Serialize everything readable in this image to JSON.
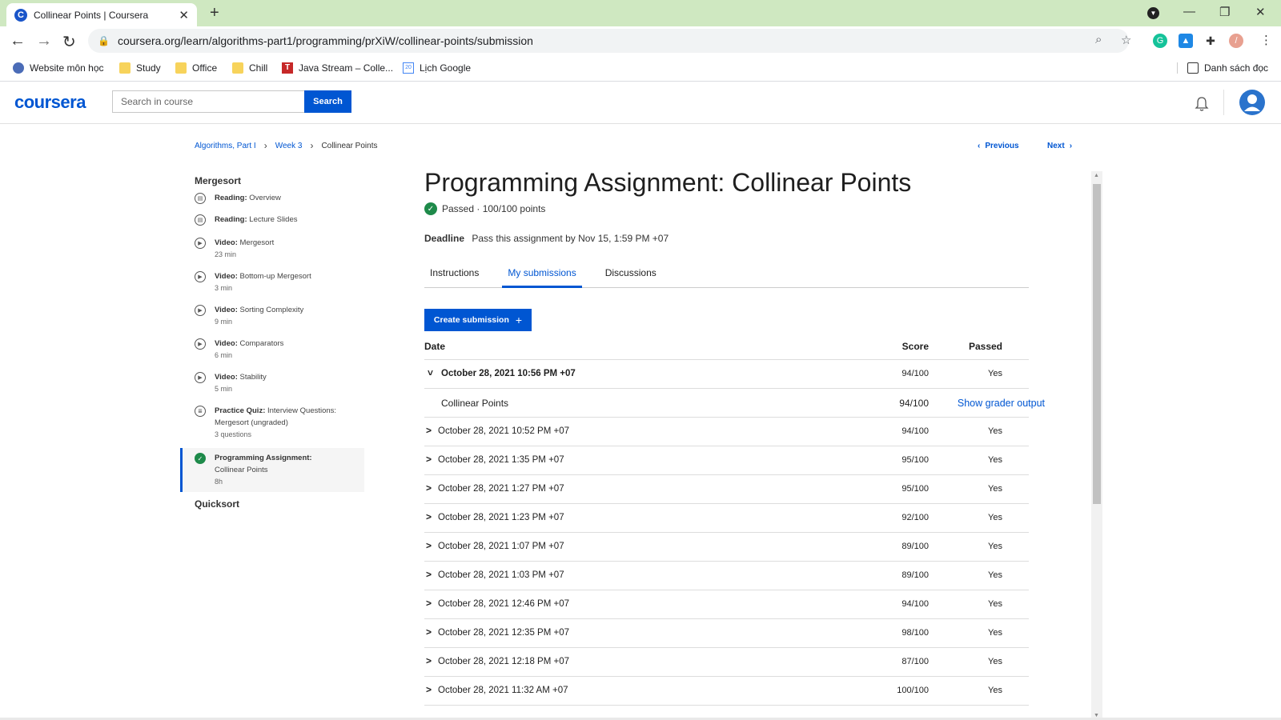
{
  "browser": {
    "tab_title": "Collinear Points | Coursera",
    "url": "coursera.org/learn/algorithms-part1/programming/prXiW/collinear-points/submission",
    "bookmarks": [
      "Website môn học",
      "Study",
      "Office",
      "Chill",
      "Java Stream – Colle...",
      "Lịch Google"
    ],
    "reading_list": "Danh sách đọc"
  },
  "header": {
    "logo": "coursera",
    "search_placeholder": "Search in course",
    "search_button": "Search"
  },
  "breadcrumb": {
    "course": "Algorithms, Part I",
    "week": "Week 3",
    "current": "Collinear Points",
    "previous": "Previous",
    "next": "Next"
  },
  "sidebar": {
    "section": "Mergesort",
    "items": [
      {
        "type": "Reading:",
        "name": "Overview",
        "meta": ""
      },
      {
        "type": "Reading:",
        "name": "Lecture Slides",
        "meta": ""
      },
      {
        "type": "Video:",
        "name": "Mergesort",
        "meta": "23 min"
      },
      {
        "type": "Video:",
        "name": "Bottom-up Mergesort",
        "meta": "3 min"
      },
      {
        "type": "Video:",
        "name": "Sorting Complexity",
        "meta": "9 min"
      },
      {
        "type": "Video:",
        "name": "Comparators",
        "meta": "6 min"
      },
      {
        "type": "Video:",
        "name": "Stability",
        "meta": "5 min"
      },
      {
        "type": "Practice Quiz:",
        "name": "Interview Questions: Mergesort (ungraded)",
        "meta": "3 questions"
      },
      {
        "type": "Programming Assignment:",
        "name": "Collinear Points",
        "meta": "8h"
      }
    ],
    "next_section": "Quicksort"
  },
  "main": {
    "title": "Programming Assignment: Collinear Points",
    "status": "Passed · 100/100 points",
    "deadline_label": "Deadline",
    "deadline_text": "Pass this assignment by Nov 15, 1:59 PM +07",
    "tabs": [
      "Instructions",
      "My submissions",
      "Discussions"
    ],
    "create_button": "Create submission",
    "table": {
      "headers": {
        "date": "Date",
        "score": "Score",
        "passed": "Passed"
      },
      "expanded_row": {
        "date": "October 28, 2021 10:56 PM +07",
        "score": "94/100",
        "passed": "Yes"
      },
      "sub_row": {
        "name": "Collinear Points",
        "score": "94/100",
        "link": "Show grader output"
      },
      "rows": [
        {
          "date": "October 28, 2021 10:52 PM +07",
          "score": "94/100",
          "passed": "Yes"
        },
        {
          "date": "October 28, 2021 1:35 PM +07",
          "score": "95/100",
          "passed": "Yes"
        },
        {
          "date": "October 28, 2021 1:27 PM +07",
          "score": "95/100",
          "passed": "Yes"
        },
        {
          "date": "October 28, 2021 1:23 PM +07",
          "score": "92/100",
          "passed": "Yes"
        },
        {
          "date": "October 28, 2021 1:07 PM +07",
          "score": "89/100",
          "passed": "Yes"
        },
        {
          "date": "October 28, 2021 1:03 PM +07",
          "score": "89/100",
          "passed": "Yes"
        },
        {
          "date": "October 28, 2021 12:46 PM +07",
          "score": "94/100",
          "passed": "Yes"
        },
        {
          "date": "October 28, 2021 12:35 PM +07",
          "score": "98/100",
          "passed": "Yes"
        },
        {
          "date": "October 28, 2021 12:18 PM +07",
          "score": "87/100",
          "passed": "Yes"
        },
        {
          "date": "October 28, 2021 11:32 AM +07",
          "score": "100/100",
          "passed": "Yes"
        }
      ]
    }
  }
}
